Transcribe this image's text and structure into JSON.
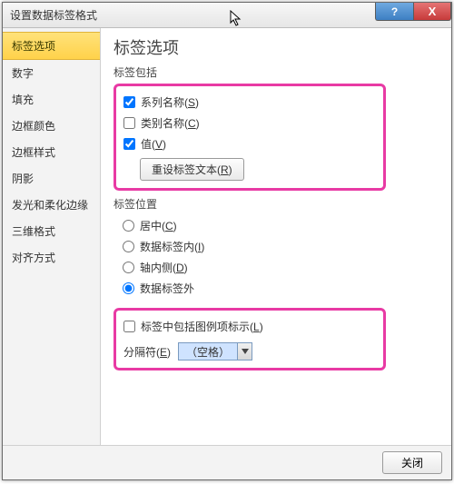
{
  "window": {
    "title": "设置数据标签格式"
  },
  "titlebar": {
    "help": "?",
    "close": "X"
  },
  "sidebar": {
    "items": [
      {
        "label": "标签选项",
        "selected": true
      },
      {
        "label": "数字"
      },
      {
        "label": "填充"
      },
      {
        "label": "边框颜色"
      },
      {
        "label": "边框样式"
      },
      {
        "label": "阴影"
      },
      {
        "label": "发光和柔化边缘"
      },
      {
        "label": "三维格式"
      },
      {
        "label": "对齐方式"
      }
    ]
  },
  "content": {
    "heading": "标签选项",
    "includes": {
      "label": "标签包括",
      "series": {
        "label": "系列名称(",
        "accel": "S",
        "tail": ")",
        "checked": true
      },
      "category": {
        "label": "类别名称(",
        "accel": "C",
        "tail": ")",
        "checked": false
      },
      "value": {
        "label": "值(",
        "accel": "V",
        "tail": ")",
        "checked": true
      },
      "resetBtn": {
        "label": "重设标签文本(",
        "accel": "R",
        "tail": ")"
      }
    },
    "position": {
      "label": "标签位置",
      "center": {
        "label": "居中(",
        "accel": "C",
        "tail": ")"
      },
      "insideEnd": {
        "label": "数据标签内(",
        "accel": "I",
        "tail": ")"
      },
      "insideBase": {
        "label": "轴内侧(",
        "accel": "D",
        "tail": ")"
      },
      "outsideEnd": {
        "label": "数据标签外",
        "accel": "",
        "tail": "",
        "checked": true
      }
    },
    "legendKey": {
      "label": "标签中包括图例项标示(",
      "accel": "L",
      "tail": ")",
      "checked": false
    },
    "separator": {
      "label": "分隔符(",
      "accel": "E",
      "tail": ")",
      "value": "（空格）"
    }
  },
  "footer": {
    "close": "关闭"
  }
}
